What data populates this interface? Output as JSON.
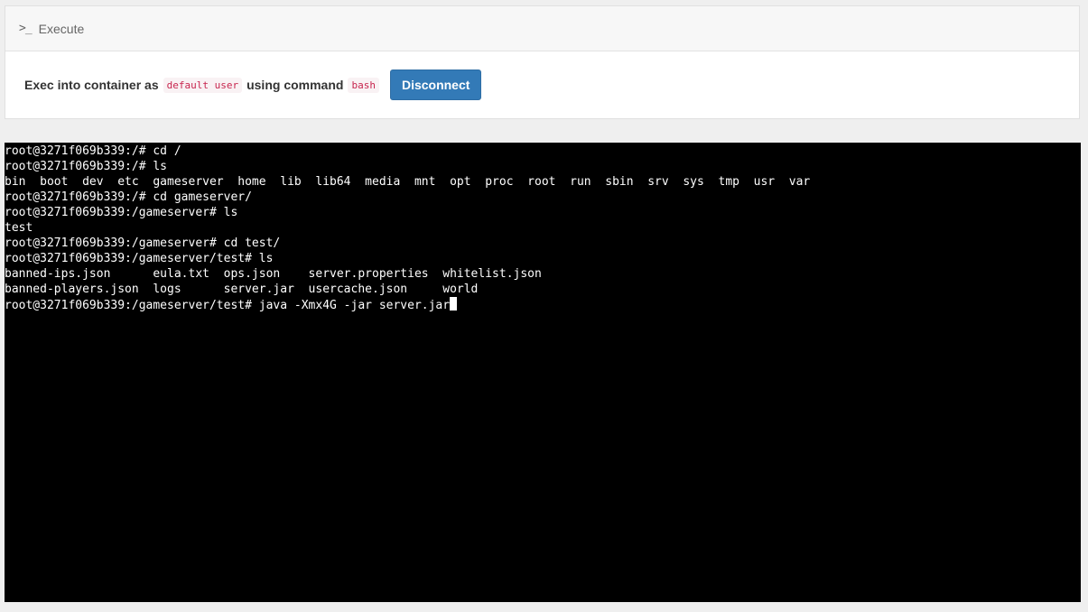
{
  "header": {
    "icon": "terminal-prompt-icon",
    "title": "Execute"
  },
  "exec": {
    "prefix": "Exec into container as",
    "user": "default user",
    "middle": "using command",
    "command": "bash",
    "button_label": "Disconnect"
  },
  "terminal": {
    "lines": [
      "root@3271f069b339:/# cd /",
      "root@3271f069b339:/# ls",
      "bin  boot  dev  etc  gameserver  home  lib  lib64  media  mnt  opt  proc  root  run  sbin  srv  sys  tmp  usr  var",
      "root@3271f069b339:/# cd gameserver/",
      "root@3271f069b339:/gameserver# ls",
      "test",
      "root@3271f069b339:/gameserver# cd test/",
      "root@3271f069b339:/gameserver/test# ls",
      "banned-ips.json      eula.txt  ops.json    server.properties  whitelist.json",
      "banned-players.json  logs      server.jar  usercache.json     world"
    ],
    "current_line": "root@3271f069b339:/gameserver/test# java -Xmx4G -jar server.jar"
  },
  "colors": {
    "accent": "#337ab7",
    "terminal_bg": "#000000",
    "terminal_fg": "#ffffff",
    "code_fg": "#c7254e"
  }
}
